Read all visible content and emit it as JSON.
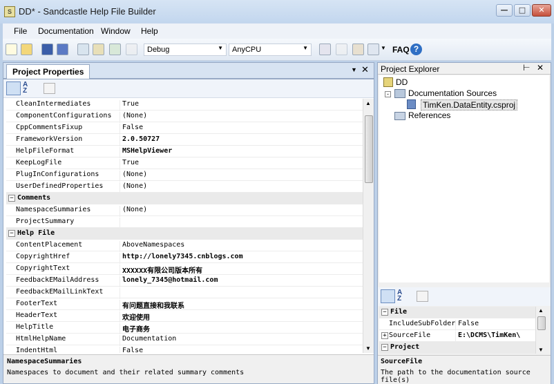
{
  "window": {
    "title": "DD* - Sandcastle Help File Builder",
    "app_icon": "sandcastle-icon"
  },
  "menu": [
    "File",
    "Documentation",
    "Window",
    "Help"
  ],
  "toolbar": {
    "configuration": "Debug",
    "platform": "AnyCPU",
    "faq_label": "FAQ"
  },
  "properties_panel": {
    "tab_label": "Project Properties",
    "rows": [
      {
        "type": "prop",
        "name": "CleanIntermediates",
        "value": "True",
        "bold": false
      },
      {
        "type": "prop",
        "name": "ComponentConfigurations",
        "value": "(None)",
        "bold": false
      },
      {
        "type": "prop",
        "name": "CppCommentsFixup",
        "value": "False",
        "bold": false
      },
      {
        "type": "prop",
        "name": "FrameworkVersion",
        "value": "2.0.50727",
        "bold": true
      },
      {
        "type": "prop",
        "name": "HelpFileFormat",
        "value": "MSHelpViewer",
        "bold": true
      },
      {
        "type": "prop",
        "name": "KeepLogFile",
        "value": "True",
        "bold": false
      },
      {
        "type": "prop",
        "name": "PlugInConfigurations",
        "value": "(None)",
        "bold": false
      },
      {
        "type": "prop",
        "name": "UserDefinedProperties",
        "value": "(None)",
        "bold": false
      },
      {
        "type": "cat",
        "name": "Comments"
      },
      {
        "type": "prop",
        "name": "NamespaceSummaries",
        "value": "(None)",
        "bold": false
      },
      {
        "type": "prop",
        "name": "ProjectSummary",
        "value": "",
        "bold": false
      },
      {
        "type": "cat",
        "name": "Help File"
      },
      {
        "type": "prop",
        "name": "ContentPlacement",
        "value": "AboveNamespaces",
        "bold": false
      },
      {
        "type": "prop",
        "name": "CopyrightHref",
        "value": "http://lonely7345.cnblogs.com",
        "bold": true
      },
      {
        "type": "prop",
        "name": "CopyrightText",
        "value": "XXXXXX有限公司版本所有",
        "bold": true
      },
      {
        "type": "prop",
        "name": "FeedbackEMailAddress",
        "value": "lonely_7345@hotmail.com",
        "bold": true
      },
      {
        "type": "prop",
        "name": "FeedbackEMailLinkText",
        "value": "",
        "bold": false
      },
      {
        "type": "prop",
        "name": "FooterText",
        "value": "有问题直接和我联系",
        "bold": true
      },
      {
        "type": "prop",
        "name": "HeaderText",
        "value": "欢迎使用",
        "bold": true
      },
      {
        "type": "prop",
        "name": "HelpTitle",
        "value": "电子商务",
        "bold": true
      },
      {
        "type": "prop",
        "name": "HtmlHelpName",
        "value": "Documentation",
        "bold": false
      },
      {
        "type": "prop",
        "name": "IndentHtml",
        "value": "False",
        "bold": false
      }
    ],
    "description_title": "NamespaceSummaries",
    "description_text": "Namespaces to document and their related summary comments"
  },
  "project_explorer": {
    "title": "Project Explorer",
    "root": "DD",
    "documentation_sources": "Documentation Sources",
    "source_file": "TimKen.DataEntity.csproj",
    "references": "References",
    "grid_rows": [
      {
        "type": "cat",
        "name": "File"
      },
      {
        "type": "prop",
        "name": "IncludeSubFolder",
        "value": "False",
        "bold": false
      },
      {
        "type": "prop_expand",
        "name": "SourceFile",
        "value": "E:\\DCMS\\TimKen\\",
        "bold": true
      },
      {
        "type": "cat",
        "name": "Project"
      }
    ],
    "description_title": "SourceFile",
    "description_text": "The path to the documentation source file(s)"
  }
}
